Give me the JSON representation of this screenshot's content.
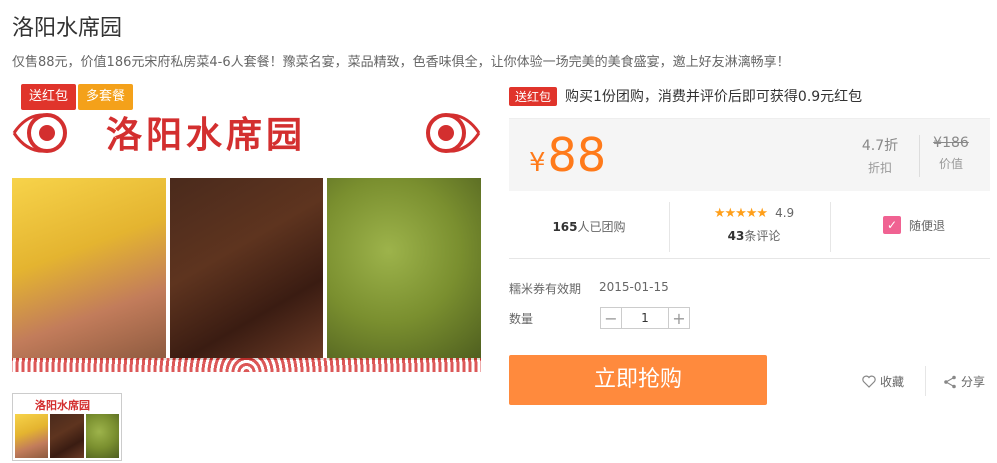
{
  "title": "洛阳水席园",
  "subtitle": "仅售88元，价值186元宋府私房菜4-6人套餐！豫菜名宴，菜品精致，色香味俱全，让你体验一场完美的美食盛宴，邀上好友淋漓畅享！",
  "banner": {
    "title": "洛阳水席园",
    "tag_red": "送红包",
    "tag_orange": "多套餐",
    "thumb_title": "洛阳水席园"
  },
  "promo": {
    "badge": "送红包",
    "text": "购买1份团购，消费并评价后即可获得0.9元红包"
  },
  "price": {
    "currency": "¥",
    "current": "88",
    "discount_value": "4.7折",
    "discount_label": "折扣",
    "original_value": "¥186",
    "original_label": "价值"
  },
  "stats": {
    "sold_count": "165",
    "sold_label": "人已团购",
    "stars": "★★★★★",
    "rating": "4.9",
    "review_count": "43",
    "review_label": "条评论",
    "refund_label": "随便退"
  },
  "validity": {
    "label": "糯米券有效期",
    "date": "2015-01-15"
  },
  "quantity": {
    "label": "数量",
    "value": "1",
    "minus": "−",
    "plus": "+"
  },
  "actions": {
    "buy": "立即抢购",
    "favorite": "收藏",
    "share": "分享"
  },
  "colors": {
    "accent_orange": "#ff8a3d",
    "price_orange": "#ff7a1a",
    "red": "#e0342b",
    "brand_red": "#d32f2f",
    "star": "#ff9f1a"
  }
}
